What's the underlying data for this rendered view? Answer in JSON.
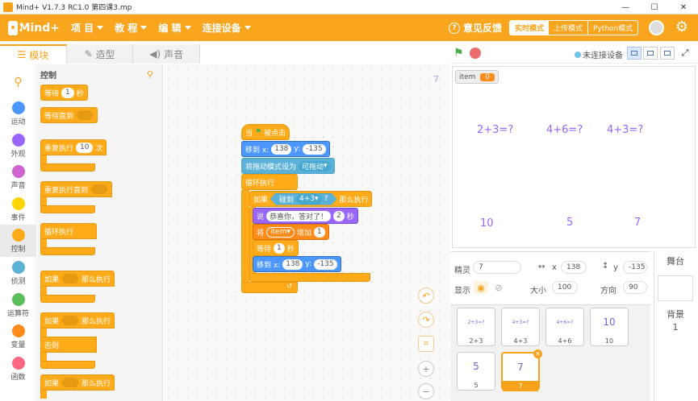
{
  "window": {
    "title": "Mind+ V1.7.3 RC1.0   第四课3.mp",
    "minimize": "—",
    "maximize": "☐",
    "close": "✕"
  },
  "menubar": {
    "logo": "Mind+",
    "items": [
      "项 目",
      "教 程",
      "编 辑",
      "连接设备"
    ],
    "feedback": "意见反馈",
    "modes": [
      "实时模式",
      "上传模式",
      "Python模式"
    ],
    "accent": "#f9a51d"
  },
  "tabs": [
    {
      "label": "模块",
      "icon": "blocks-icon"
    },
    {
      "label": "造型",
      "icon": "brush-icon"
    },
    {
      "label": "声音",
      "icon": "speaker-icon"
    }
  ],
  "categories": [
    {
      "label": "运动",
      "color": "#4c97ff"
    },
    {
      "label": "外观",
      "color": "#9966ff"
    },
    {
      "label": "声音",
      "color": "#cf63cf"
    },
    {
      "label": "事件",
      "color": "#ffd500"
    },
    {
      "label": "控制",
      "color": "#ffab19"
    },
    {
      "label": "侦测",
      "color": "#5cb1d6"
    },
    {
      "label": "运算符",
      "color": "#59c059"
    },
    {
      "label": "变量",
      "color": "#ff8c1a"
    },
    {
      "label": "函数",
      "color": "#ff6680"
    }
  ],
  "palette": {
    "title": "控制",
    "wait": "等待",
    "wait_val": "1",
    "seconds": "秒",
    "wait_until": "等待直到",
    "repeat": "重复执行",
    "repeat_val": "10",
    "times": "次",
    "repeat_until": "重复执行直到",
    "forever": "循环执行",
    "if": "如果",
    "then": "那么执行",
    "else": "否则"
  },
  "script": {
    "hat": "当",
    "hat_suffix": "被点击",
    "goto1": "移到 x:",
    "x1": "138",
    "y_label": "y:",
    "y1": "-135",
    "drag": "将拖动模式设为",
    "drag_val": "可拖动",
    "forever": "循环执行",
    "if": "如果",
    "touching": "碰到",
    "touch_val": "4+3",
    "q": "?",
    "then": "那么执行",
    "say": "说",
    "say_text": "恭喜你，答对了！",
    "say_secs": "2",
    "sec": "秒",
    "change": "将",
    "var_name": "item",
    "change_by": "增加",
    "change_val": "1",
    "wait": "等待",
    "wait_val": "1",
    "wait_sec": "秒",
    "goto2": "移到 x:",
    "x2": "138",
    "y2_label": "y:",
    "y2": "-135"
  },
  "workspace_num": "7",
  "stage": {
    "connection": "未连接设备",
    "monitor_name": "item",
    "monitor_value": "0",
    "questions": [
      "2+3=?",
      "4+6=?",
      "4+3=?"
    ],
    "answers": [
      "10",
      "5",
      "7"
    ]
  },
  "sprite_props": {
    "sprite_label": "精灵",
    "sprite_name": "7",
    "x_label": "x",
    "x": "138",
    "y_label": "y",
    "y": "-135",
    "show_label": "显示",
    "size_label": "大小",
    "size": "100",
    "dir_label": "方向",
    "dir": "90"
  },
  "sprites": [
    {
      "name": "2+3",
      "thumb": "2+3=?"
    },
    {
      "name": "4+3",
      "thumb": "4+3=?"
    },
    {
      "name": "4+6",
      "thumb": "4+6=?"
    },
    {
      "name": "10",
      "thumb": "10"
    },
    {
      "name": "5",
      "thumb": "5"
    },
    {
      "name": "7",
      "thumb": "7"
    }
  ],
  "stage_panel": {
    "title": "舞台",
    "bg_label": "背景",
    "bg_count": "1"
  }
}
